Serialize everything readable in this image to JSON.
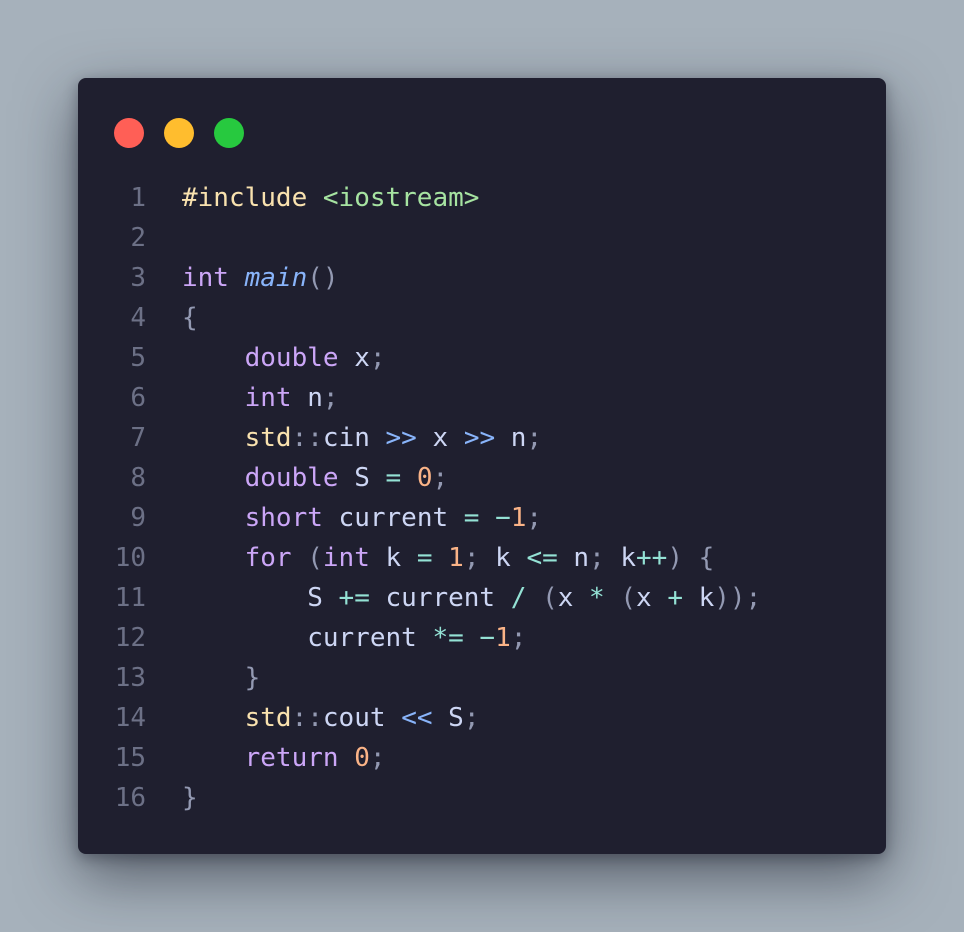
{
  "window": {
    "traffic_lights": [
      "close",
      "minimize",
      "maximize"
    ],
    "colors": {
      "close": "#ff5f56",
      "minimize": "#ffbd2e",
      "maximize": "#27c93f",
      "background": "#1f1f2f"
    }
  },
  "code": {
    "language": "cpp",
    "lines": [
      {
        "n": "1",
        "tokens": [
          [
            "pp",
            "#include"
          ],
          [
            "var",
            " "
          ],
          [
            "str",
            "<iostream>"
          ]
        ]
      },
      {
        "n": "2",
        "tokens": []
      },
      {
        "n": "3",
        "tokens": [
          [
            "kw",
            "int"
          ],
          [
            "var",
            " "
          ],
          [
            "fn",
            "main"
          ],
          [
            "pun",
            "()"
          ]
        ]
      },
      {
        "n": "4",
        "tokens": [
          [
            "pun",
            "{"
          ]
        ]
      },
      {
        "n": "5",
        "tokens": [
          [
            "var",
            "    "
          ],
          [
            "kw",
            "double"
          ],
          [
            "var",
            " x"
          ],
          [
            "pun",
            ";"
          ]
        ]
      },
      {
        "n": "6",
        "tokens": [
          [
            "var",
            "    "
          ],
          [
            "kw",
            "int"
          ],
          [
            "var",
            " n"
          ],
          [
            "pun",
            ";"
          ]
        ]
      },
      {
        "n": "7",
        "tokens": [
          [
            "var",
            "    "
          ],
          [
            "ns",
            "std"
          ],
          [
            "pun",
            "::"
          ],
          [
            "var",
            "cin "
          ],
          [
            "op2",
            ">>"
          ],
          [
            "var",
            " x "
          ],
          [
            "op2",
            ">>"
          ],
          [
            "var",
            " n"
          ],
          [
            "pun",
            ";"
          ]
        ]
      },
      {
        "n": "8",
        "tokens": [
          [
            "var",
            "    "
          ],
          [
            "kw",
            "double"
          ],
          [
            "var",
            " S "
          ],
          [
            "op",
            "="
          ],
          [
            "var",
            " "
          ],
          [
            "num",
            "0"
          ],
          [
            "pun",
            ";"
          ]
        ]
      },
      {
        "n": "9",
        "tokens": [
          [
            "var",
            "    "
          ],
          [
            "kw",
            "short"
          ],
          [
            "var",
            " current "
          ],
          [
            "op",
            "="
          ],
          [
            "var",
            " "
          ],
          [
            "op",
            "−"
          ],
          [
            "num",
            "1"
          ],
          [
            "pun",
            ";"
          ]
        ]
      },
      {
        "n": "10",
        "tokens": [
          [
            "var",
            "    "
          ],
          [
            "kw",
            "for"
          ],
          [
            "var",
            " "
          ],
          [
            "pun",
            "("
          ],
          [
            "kw",
            "int"
          ],
          [
            "var",
            " k "
          ],
          [
            "op",
            "="
          ],
          [
            "var",
            " "
          ],
          [
            "num",
            "1"
          ],
          [
            "pun",
            ";"
          ],
          [
            "var",
            " k "
          ],
          [
            "op",
            "<="
          ],
          [
            "var",
            " n"
          ],
          [
            "pun",
            ";"
          ],
          [
            "var",
            " k"
          ],
          [
            "op",
            "++"
          ],
          [
            "pun",
            ")"
          ],
          [
            "var",
            " "
          ],
          [
            "pun",
            "{"
          ]
        ]
      },
      {
        "n": "11",
        "tokens": [
          [
            "var",
            "        S "
          ],
          [
            "op",
            "+="
          ],
          [
            "var",
            " current "
          ],
          [
            "op",
            "/"
          ],
          [
            "var",
            " "
          ],
          [
            "pun",
            "("
          ],
          [
            "var",
            "x "
          ],
          [
            "op",
            "*"
          ],
          [
            "var",
            " "
          ],
          [
            "pun",
            "("
          ],
          [
            "var",
            "x "
          ],
          [
            "op",
            "+"
          ],
          [
            "var",
            " k"
          ],
          [
            "pun",
            "));"
          ]
        ]
      },
      {
        "n": "12",
        "tokens": [
          [
            "var",
            "        current "
          ],
          [
            "op",
            "*="
          ],
          [
            "var",
            " "
          ],
          [
            "op",
            "−"
          ],
          [
            "num",
            "1"
          ],
          [
            "pun",
            ";"
          ]
        ]
      },
      {
        "n": "13",
        "tokens": [
          [
            "var",
            "    "
          ],
          [
            "pun",
            "}"
          ]
        ]
      },
      {
        "n": "14",
        "tokens": [
          [
            "var",
            "    "
          ],
          [
            "ns",
            "std"
          ],
          [
            "pun",
            "::"
          ],
          [
            "var",
            "cout "
          ],
          [
            "op2",
            "<<"
          ],
          [
            "var",
            " S"
          ],
          [
            "pun",
            ";"
          ]
        ]
      },
      {
        "n": "15",
        "tokens": [
          [
            "var",
            "    "
          ],
          [
            "kw",
            "return"
          ],
          [
            "var",
            " "
          ],
          [
            "num",
            "0"
          ],
          [
            "pun",
            ";"
          ]
        ]
      },
      {
        "n": "16",
        "tokens": [
          [
            "pun",
            "}"
          ]
        ]
      }
    ]
  }
}
